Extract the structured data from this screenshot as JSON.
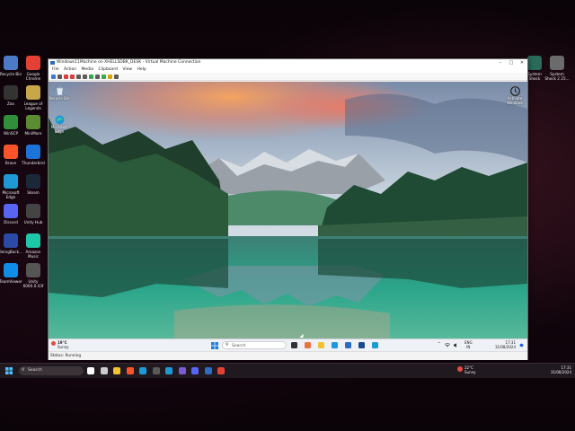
{
  "host_desktop": {
    "icons_left": [
      {
        "label": "Recycle Bin",
        "icon": "recycle-bin-icon",
        "color": "#4c7ac9"
      },
      {
        "label": "Google\nChrome",
        "icon": "chrome-icon",
        "color": "#e44134"
      },
      {
        "label": "Zoo",
        "icon": "zoo-icon",
        "color": "#333333"
      },
      {
        "label": "League of\nLegends",
        "icon": "league-icon",
        "color": "#c8a74a"
      },
      {
        "label": "WinSCP",
        "icon": "winscp-icon",
        "color": "#2f8f3a"
      },
      {
        "label": "MiniMore",
        "icon": "minimore-icon",
        "color": "#5b8c31"
      },
      {
        "label": "Brave",
        "icon": "brave-icon",
        "color": "#fb542b"
      },
      {
        "label": "Thunderbird",
        "icon": "thunderbird-icon",
        "color": "#1e73d8"
      },
      {
        "label": "Microsoft\nEdge",
        "icon": "edge-icon",
        "color": "#1d9ad6"
      },
      {
        "label": "Steam",
        "icon": "steam-icon",
        "color": "#1b2838"
      },
      {
        "label": "Discord",
        "icon": "discord-icon",
        "color": "#5865f2"
      },
      {
        "label": "Unity Hub",
        "icon": "unity-icon",
        "color": "#444444"
      },
      {
        "label": "BeingBack...",
        "icon": "app-icon",
        "color": "#2b4aa8"
      },
      {
        "label": "Amazon\nMusic",
        "icon": "amazon-music-icon",
        "color": "#1ec7a8"
      },
      {
        "label": "TeamViewer",
        "icon": "teamviewer-icon",
        "color": "#0e8ee9"
      },
      {
        "label": "Unity\n6000.0.43f",
        "icon": "unity-icon",
        "color": "#555555"
      }
    ],
    "icons_right": [
      {
        "label": "System\nShock",
        "icon": "system-shock-icon",
        "color": "#2a6b5a"
      },
      {
        "label": "System\nShock 2 25...",
        "icon": "system-shock-2-icon",
        "color": "#6b6b6b"
      }
    ]
  },
  "vm_window": {
    "title": "Windows11Machine on XHELLSDBK_DESK - Virtual Machine Connection",
    "controls": [
      "–",
      "□",
      "✕"
    ],
    "menu": [
      "File",
      "Action",
      "Media",
      "Clipboard",
      "View",
      "Help"
    ],
    "toolbar_colors": [
      "#3b7bd6",
      "#5a5a5a",
      "#d64040",
      "#d64040",
      "#5a5a5a",
      "#5a5a5a",
      "#3aa84a",
      "#5a5a5a",
      "#3aa84a",
      "#d6a400",
      "#5a5a5a"
    ],
    "status": "Status: Running"
  },
  "guest": {
    "icons": [
      {
        "label": "Recycle Bin",
        "icon": "recycle-bin-icon"
      },
      {
        "label": "Microsoft\nEdge",
        "icon": "edge-icon"
      }
    ],
    "right_icon": {
      "label": "Activate\nWindows",
      "icon": "clock-icon"
    },
    "taskbar": {
      "weather_temp": "19°C",
      "weather_desc": "Sunny",
      "search_placeholder": "Search",
      "app_colors": [
        "#333333",
        "#e8743b",
        "#f2c230",
        "#1d9ad6",
        "#2b6cc4",
        "#1b4a8c",
        "#1d9ad6"
      ],
      "tray_lang": "ENG",
      "tray_region": "IN",
      "time": "17:31",
      "date": "31/08/2024"
    }
  },
  "host_taskbar": {
    "search_placeholder": "Search",
    "app_colors": [
      "#ffffff",
      "#cccccc",
      "#f2c230",
      "#fb542b",
      "#1d9ad6",
      "#5a5a5a",
      "#1d9ad6",
      "#7b5bd8",
      "#5865f2",
      "#2b6cc4",
      "#e44134"
    ],
    "weather_temp": "22°C",
    "weather_desc": "Sunny",
    "time": "17:31",
    "date": "31/08/2024"
  }
}
